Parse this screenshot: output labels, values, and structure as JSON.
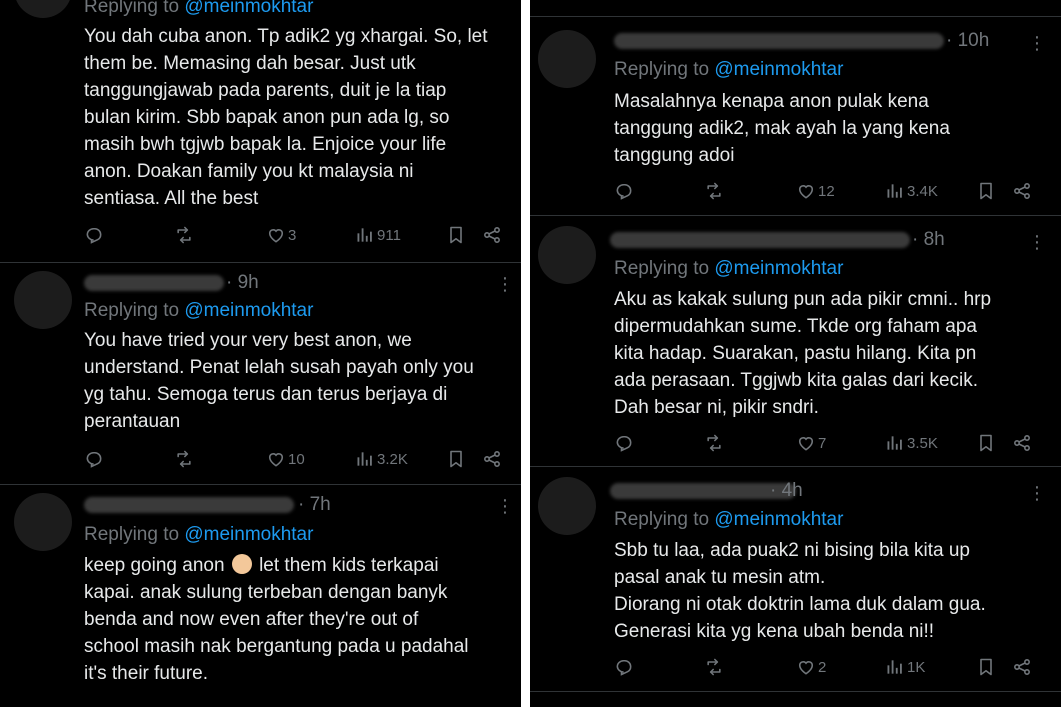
{
  "left": {
    "t1": {
      "replying_prefix": "Replying to ",
      "handle": "@meinmokhtar",
      "text": "You dah cuba anon. Tp adik2 yg xhargai. So, let\nthem be. Memasing dah besar. Just utk\ntanggungjawab pada parents, duit je la tiap\nbulan kirim. Sbb bapak anon pun ada lg, so\nmasih bwh tgjwb bapak la. Enjoice your life\nanon. Doakan family you kt malaysia ni\nsentiasa. All the best",
      "likes": "3",
      "views": "911"
    },
    "t2": {
      "time": "· 9h",
      "replying_prefix": "Replying to ",
      "handle": "@meinmokhtar",
      "text": "You have tried your very best anon, we\nunderstand. Penat lelah susah payah only you\nyg tahu. Semoga terus dan terus berjaya di\nperantauan",
      "likes": "10",
      "views": "3.2K"
    },
    "t3": {
      "time": "· 7h",
      "replying_prefix": "Replying to ",
      "handle": "@meinmokhtar",
      "text_a": "keep going anon ",
      "text_b": " let them kids terkapai",
      "text_c": "kapai. anak sulung terbeban dengan banyk\nbenda and now even after they're out of\nschool masih nak bergantung pada u padahal\nit's their future."
    }
  },
  "right": {
    "t1": {
      "time": "· 10h",
      "replying_prefix": "Replying to ",
      "handle": "@meinmokhtar",
      "text": "Masalahnya kenapa anon pulak kena\ntanggung adik2, mak ayah la yang kena\ntanggung adoi",
      "likes": "12",
      "views": "3.4K"
    },
    "t2": {
      "time": "· 8h",
      "replying_prefix": "Replying to ",
      "handle": "@meinmokhtar",
      "text": "Aku as kakak sulung pun ada pikir cmni.. hrp\ndipermudahkan sume. Tkde org faham apa\nkita hadap. Suarakan, pastu hilang. Kita pn\nada perasaan. Tggjwb kita galas dari kecik.\nDah besar ni, pikir sndri.",
      "likes": "7",
      "views": "3.5K"
    },
    "t3": {
      "time": "· 4h",
      "replying_prefix": "Replying to ",
      "handle": "@meinmokhtar",
      "text": "Sbb tu laa, ada puak2 ni bising bila kita up\npasal anak tu mesin atm.\nDiorang ni otak doktrin lama duk dalam gua.\nGenerasi kita yg kena ubah benda ni!!",
      "likes": "2",
      "views": "1K"
    }
  },
  "icons": {
    "reply": "reply-icon",
    "retweet": "retweet-icon",
    "like": "heart-icon",
    "views": "views-icon",
    "bookmark": "bookmark-icon",
    "share": "share-icon",
    "more": "more-icon"
  },
  "colors": {
    "background": "#000000",
    "text": "#e7e9ea",
    "muted": "#71767b",
    "link": "#1d9bf0",
    "divider": "#2f3336"
  }
}
